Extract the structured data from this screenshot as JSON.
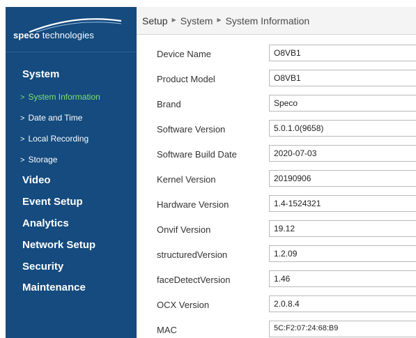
{
  "brand": {
    "name_bold": "speco",
    "name_rest": " technologies",
    "accent": "#154b7e",
    "active_color": "#7ee06c"
  },
  "sidebar": {
    "items": [
      {
        "label": "System",
        "type": "section"
      },
      {
        "label": "System Information",
        "type": "sub",
        "active": true
      },
      {
        "label": "Date and Time",
        "type": "sub"
      },
      {
        "label": "Local Recording",
        "type": "sub"
      },
      {
        "label": "Storage",
        "type": "sub"
      },
      {
        "label": "Video",
        "type": "section"
      },
      {
        "label": "Event Setup",
        "type": "section"
      },
      {
        "label": "Analytics",
        "type": "section"
      },
      {
        "label": "Network Setup",
        "type": "section"
      },
      {
        "label": "Security",
        "type": "section"
      },
      {
        "label": "Maintenance",
        "type": "section"
      }
    ]
  },
  "breadcrumb": [
    "Setup",
    "System",
    "System Information"
  ],
  "fields": [
    {
      "label": "Device Name",
      "value": "O8VB1"
    },
    {
      "label": "Product Model",
      "value": "O8VB1"
    },
    {
      "label": "Brand",
      "value": "Speco"
    },
    {
      "label": "Software Version",
      "value": "5.0.1.0(9658)"
    },
    {
      "label": "Software Build Date",
      "value": "2020-07-03"
    },
    {
      "label": "Kernel Version",
      "value": "20190906"
    },
    {
      "label": "Hardware Version",
      "value": "1.4-1524321"
    },
    {
      "label": "Onvif Version",
      "value": "19.12"
    },
    {
      "label": "structuredVersion",
      "value": "1.2.09"
    },
    {
      "label": "faceDetectVersion",
      "value": "1.46"
    },
    {
      "label": "OCX Version",
      "value": "2.0.8.4"
    },
    {
      "label": "MAC",
      "value": "5C:F2:07:24:68:B9"
    }
  ]
}
